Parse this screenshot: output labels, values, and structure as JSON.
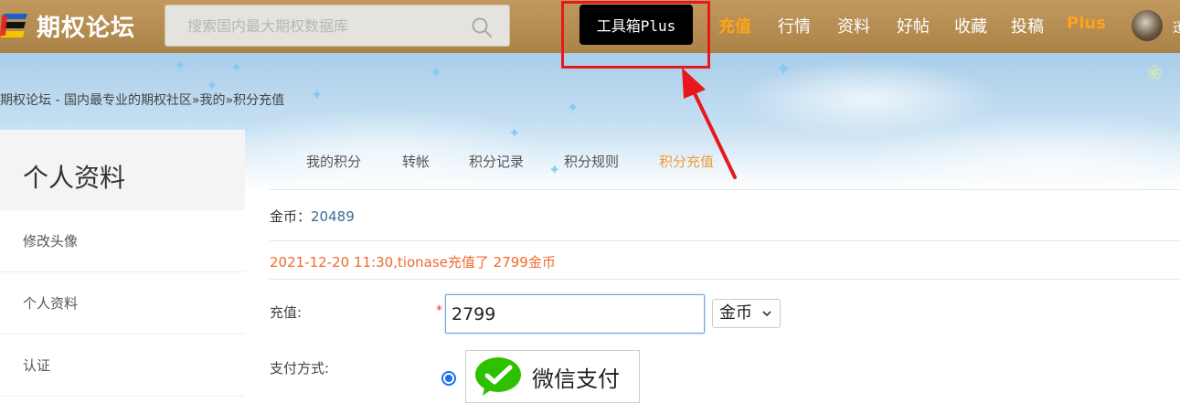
{
  "header": {
    "logo_text": "期权论坛",
    "search_placeholder": "搜索国内最大期权数据库",
    "toolbox_label": "工具箱Plus",
    "nav": [
      {
        "label": "充值",
        "accent": true
      },
      {
        "label": "行情"
      },
      {
        "label": "资料"
      },
      {
        "label": "好帖"
      },
      {
        "label": "收藏"
      },
      {
        "label": "投稿"
      },
      {
        "label": "Plus",
        "accent": true
      }
    ],
    "user_name_cut": "迅"
  },
  "breadcrumb": {
    "site": "期权论坛 - 国内最专业的期权社区",
    "sep1": "»",
    "mine": "我的",
    "sep2": "»",
    "current": "积分充值"
  },
  "sidebar": {
    "title": "个人资料",
    "items": [
      {
        "label": "修改头像"
      },
      {
        "label": "个人资料"
      },
      {
        "label": "认证"
      }
    ]
  },
  "tabs": [
    {
      "label": "我的积分"
    },
    {
      "label": "转帐"
    },
    {
      "label": "积分记录"
    },
    {
      "label": "积分规则"
    },
    {
      "label": "积分充值",
      "active": true
    }
  ],
  "gold": {
    "label": "金币：",
    "value": "20489"
  },
  "notice": "2021-12-20 11:30,tionase充值了 2799金币",
  "recharge": {
    "label": "充值:",
    "required_mark": "*",
    "amount": "2799",
    "currency": "金币"
  },
  "payment": {
    "label": "支付方式:",
    "option_label": "微信支付",
    "selected": true
  },
  "colors": {
    "nav_bg": "#ab8247",
    "accent": "#ffa31a",
    "active_tab": "#f29b37",
    "notice": "#f06a2e",
    "annotation": "#e8171d"
  }
}
